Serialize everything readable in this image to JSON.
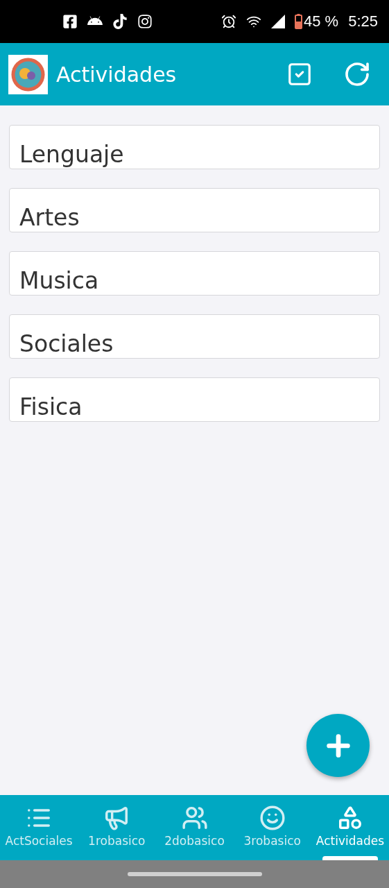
{
  "status_bar": {
    "battery": "45 %",
    "time": "5:25"
  },
  "app_bar": {
    "title": "Actividades"
  },
  "items": [
    {
      "label": "Lenguaje"
    },
    {
      "label": "Artes"
    },
    {
      "label": "Musica"
    },
    {
      "label": "Sociales"
    },
    {
      "label": "Fisica"
    }
  ],
  "bottom_nav": [
    {
      "label": "ActSociales",
      "selected": false
    },
    {
      "label": "1robasico",
      "selected": false
    },
    {
      "label": "2dobasico",
      "selected": false
    },
    {
      "label": "3robasico",
      "selected": false
    },
    {
      "label": "Actividades",
      "selected": true
    }
  ]
}
